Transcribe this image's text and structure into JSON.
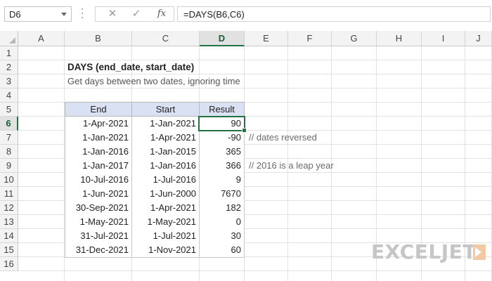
{
  "name_box": "D6",
  "formula_bar": {
    "cancel_glyph": "✕",
    "enter_glyph": "✓",
    "fx_label": "fx",
    "formula": "=DAYS(B6,C6)"
  },
  "columns": [
    "A",
    "B",
    "C",
    "D",
    "E",
    "F",
    "G",
    "H",
    "I",
    "J"
  ],
  "rows": [
    "1",
    "2",
    "3",
    "4",
    "5",
    "6",
    "7",
    "8",
    "9",
    "10",
    "11",
    "12",
    "13",
    "14",
    "15",
    "16"
  ],
  "selected_column": "D",
  "selected_row": "6",
  "sheet": {
    "title": "DAYS (end_date, start_date)",
    "subtitle": "Get days between two dates, ignoring time",
    "headers": [
      "End",
      "Start",
      "Result"
    ],
    "data_rows": [
      {
        "end": "1-Apr-2021",
        "start": "1-Jan-2021",
        "result": "90",
        "note": ""
      },
      {
        "end": "1-Jan-2021",
        "start": "1-Apr-2021",
        "result": "-90",
        "note": "// dates reversed"
      },
      {
        "end": "1-Jan-2016",
        "start": "1-Jan-2015",
        "result": "365",
        "note": ""
      },
      {
        "end": "1-Jan-2017",
        "start": "1-Jan-2016",
        "result": "366",
        "note": "// 2016 is a leap year"
      },
      {
        "end": "10-Jul-2016",
        "start": "1-Jul-2016",
        "result": "9",
        "note": ""
      },
      {
        "end": "1-Jun-2021",
        "start": "1-Jun-2000",
        "result": "7670",
        "note": ""
      },
      {
        "end": "30-Sep-2021",
        "start": "1-Apr-2021",
        "result": "182",
        "note": ""
      },
      {
        "end": "1-May-2021",
        "start": "1-May-2021",
        "result": "0",
        "note": ""
      },
      {
        "end": "31-Jul-2021",
        "start": "1-Jul-2021",
        "result": "30",
        "note": ""
      },
      {
        "end": "31-Dec-2021",
        "start": "1-Nov-2021",
        "result": "60",
        "note": ""
      }
    ]
  },
  "logo": {
    "text": "EXCELJET",
    "color": "#c6c6c6",
    "accent": "#f0b07a"
  },
  "colors": {
    "accent_green": "#217346",
    "table_header_bg": "#d9e1f2"
  }
}
